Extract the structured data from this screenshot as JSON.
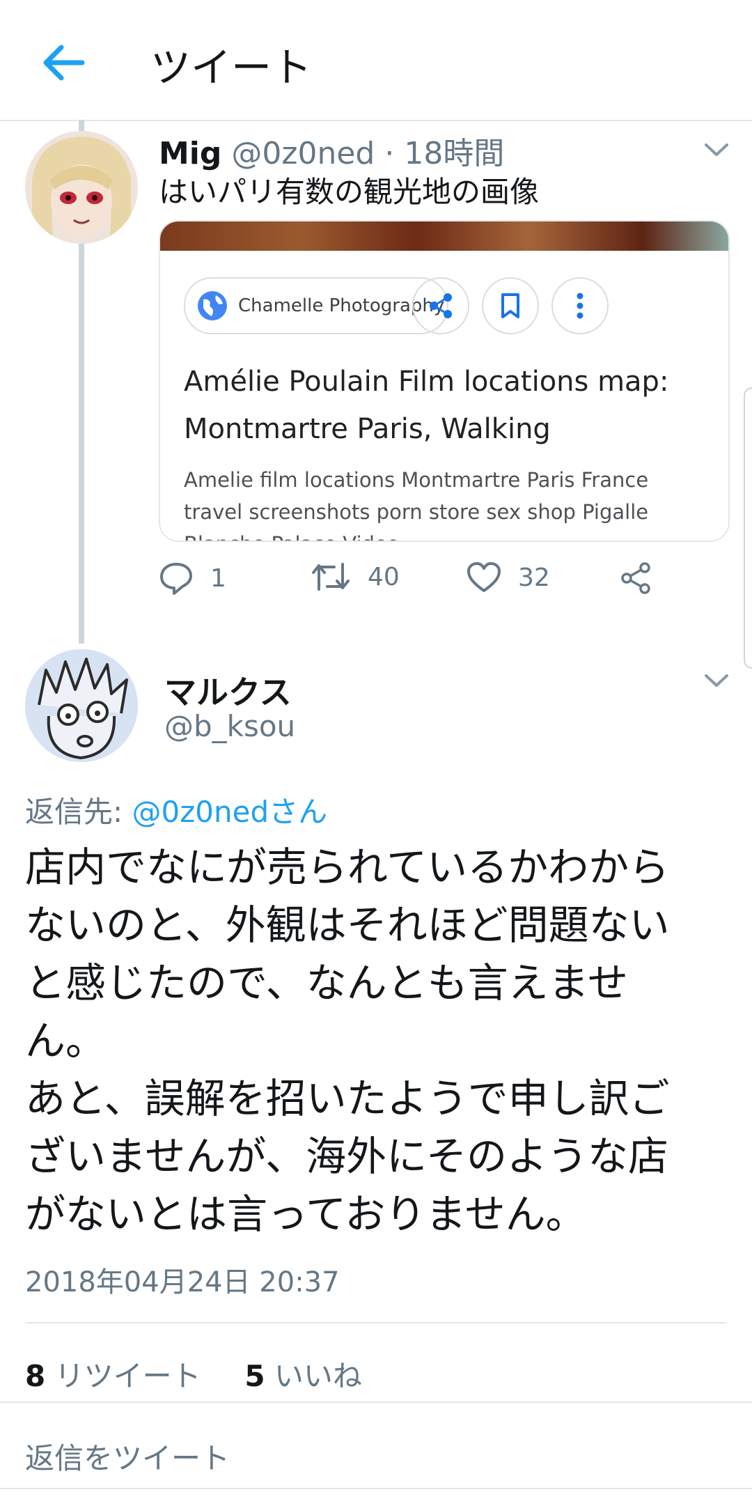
{
  "header": {
    "title": "ツイート"
  },
  "tweet1": {
    "name": "Mig",
    "handle": "@0z0ned",
    "separator": "·",
    "time": "18時間",
    "text": "はいパリ有数の観光地の画像",
    "card": {
      "source": "Chamelle Photography",
      "title": "Amélie Poulain Film locations map: Montmartre Paris, Walking",
      "description": "Amelie film locations Montmartre Paris France travel screenshots porn store sex shop Pigalle Blanche Palace Video"
    },
    "actions": {
      "replies": "1",
      "retweets": "40",
      "likes": "32"
    }
  },
  "tweet2": {
    "name": "マルクス",
    "handle": "@b_ksou",
    "reply_prefix": "返信先: ",
    "reply_to": "@0z0nedさん",
    "text": "店内でなにが売られているかわから\nないのと、外観はそれほど問題ない\nと感じたので、なんとも言えませ\nん。\nあと、誤解を招いたようで申し訳ご\nざいませんが、海外にそのような店\nがないとは言っておりません。",
    "timestamp": "2018年04月24日 20:37",
    "retweet_count": "8",
    "retweet_label": "リツイート",
    "like_count": "5",
    "like_label": "いいね"
  },
  "reply_box": {
    "placeholder": "返信をツイート"
  },
  "colors": {
    "accent": "#1da1f2",
    "muted": "#657786",
    "divider": "#e1e8ed"
  },
  "icons": [
    "back-arrow-icon",
    "chevron-down-icon",
    "globe-icon",
    "share-icon",
    "bookmark-icon",
    "more-vertical-icon",
    "reply-icon",
    "retweet-icon",
    "like-icon",
    "share-nodes-icon"
  ]
}
